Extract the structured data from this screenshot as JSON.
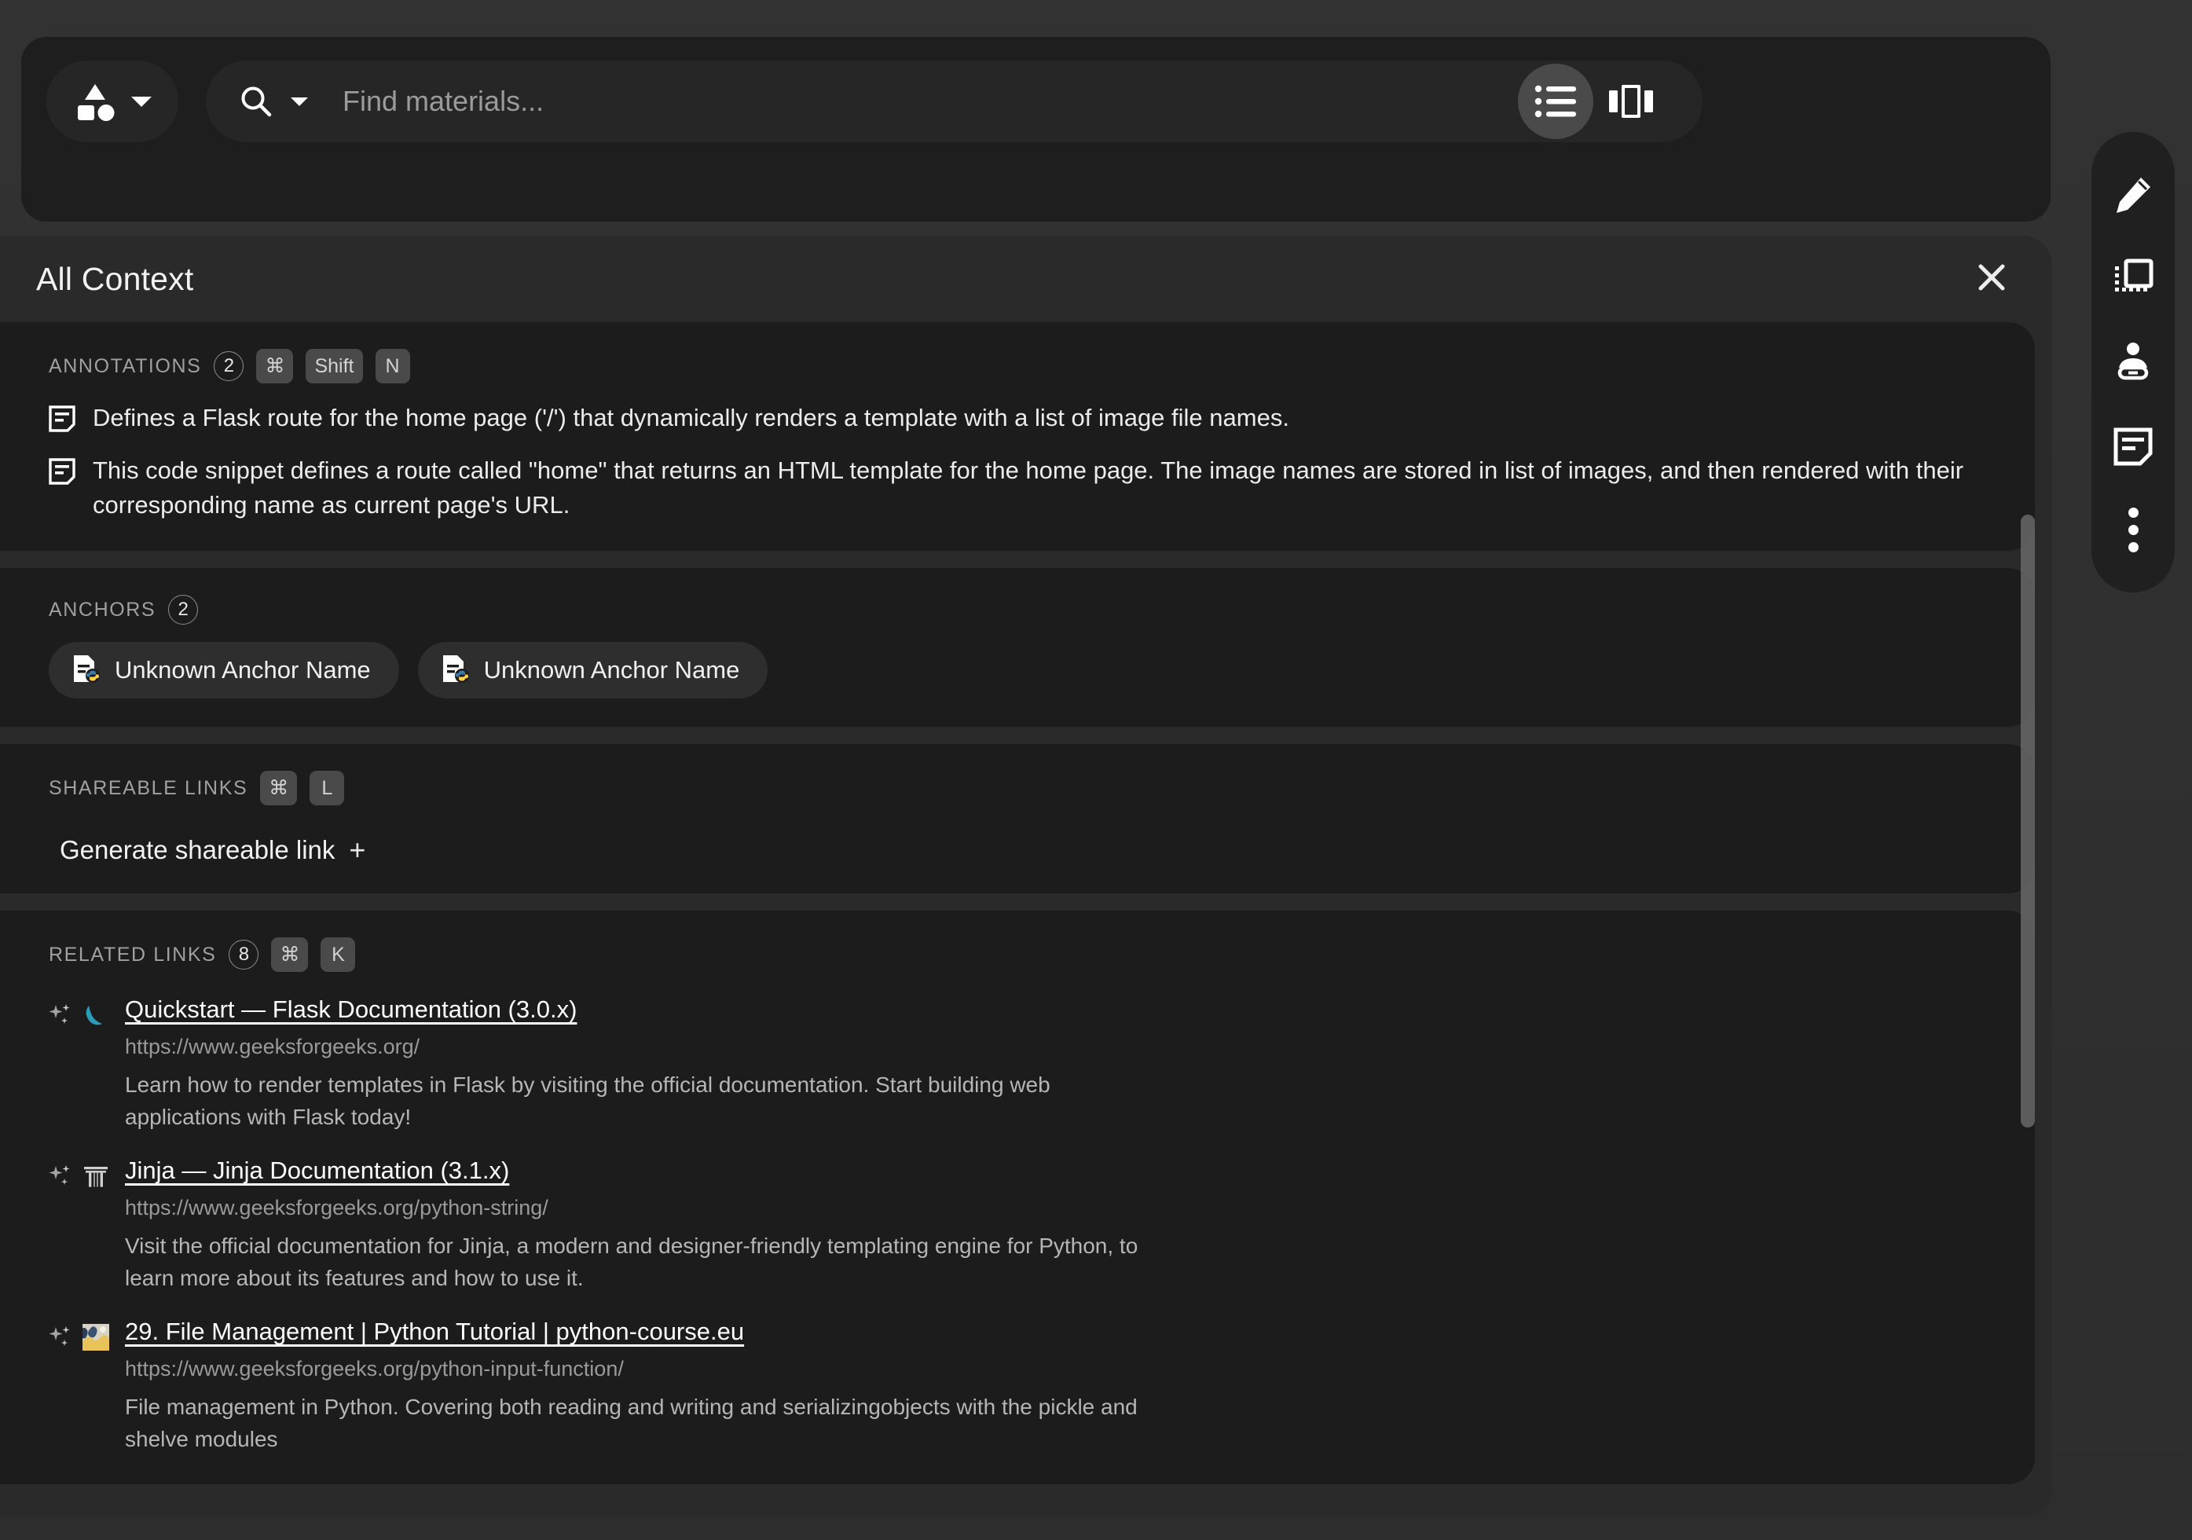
{
  "topbar": {
    "lens_button": {
      "icon": "shapes-icon",
      "caret": "chevron-down-icon"
    },
    "search": {
      "icon": "search-icon",
      "caret": "chevron-down-icon",
      "placeholder": "Find materials...",
      "value": ""
    },
    "slash_shortcut": "/",
    "avatar": {
      "name": "user-avatar",
      "presence": "online",
      "presence_color": "#22c55e"
    },
    "view_toggle": {
      "list_view": {
        "label": "list-view",
        "active": true
      },
      "card_view": {
        "label": "card-view",
        "active": false
      }
    }
  },
  "panel": {
    "title": "All Context",
    "close_label": "×"
  },
  "annotations": {
    "label": "ANNOTATIONS",
    "count": "2",
    "shortcut": [
      "⌘",
      "Shift",
      "N"
    ],
    "items": [
      "Defines a Flask route for the home page ('/') that dynamically renders a template with a list of image file names.",
      "This code snippet defines a route called \"home\" that returns an HTML template for the home page. The image names are stored in list of images, and then rendered with their corresponding name as current page's URL."
    ]
  },
  "anchors": {
    "label": "ANCHORS",
    "count": "2",
    "items": [
      {
        "name": "Unknown Anchor Name",
        "icon": "python-file-icon"
      },
      {
        "name": "Unknown Anchor Name",
        "icon": "python-file-icon"
      }
    ]
  },
  "shareable_links": {
    "label": "SHAREABLE LINKS",
    "shortcut": [
      "⌘",
      "L"
    ],
    "generate_label": "Generate shareable link",
    "plus": "+"
  },
  "related_links": {
    "label": "RELATED LINKS",
    "count": "8",
    "shortcut": [
      "⌘",
      "K"
    ],
    "items": [
      {
        "title": "Quickstart — Flask Documentation (3.0.x)",
        "url": "https://www.geeksforgeeks.org/",
        "description": "Learn how to render templates in Flask by visiting the official documentation. Start building web applications with Flask today!",
        "favicon": "flask-logo",
        "ai_badge": "sparkles-icon"
      },
      {
        "title": "Jinja — Jinja Documentation (3.1.x)",
        "url": "https://www.geeksforgeeks.org/python-string/",
        "description": "Visit the official documentation for Jinja, a modern and designer-friendly templating engine for Python, to learn more about its features and how to use it.",
        "favicon": "torii-gate-logo",
        "ai_badge": "sparkles-icon"
      },
      {
        "title": "29. File Management | Python Tutorial | python-course.eu",
        "url": "https://www.geeksforgeeks.org/python-input-function/",
        "description": "File management in Python. Covering both reading and writing and serializingobjects with the pickle and shelve modules",
        "favicon": "python-course-logo",
        "ai_badge": "sparkles-icon"
      }
    ]
  },
  "rail": {
    "buttons": [
      {
        "name": "edit-pencil-icon"
      },
      {
        "name": "anchor-frame-icon"
      },
      {
        "name": "share-person-link-icon"
      },
      {
        "name": "annotation-note-icon"
      },
      {
        "name": "more-options-icon"
      }
    ]
  }
}
